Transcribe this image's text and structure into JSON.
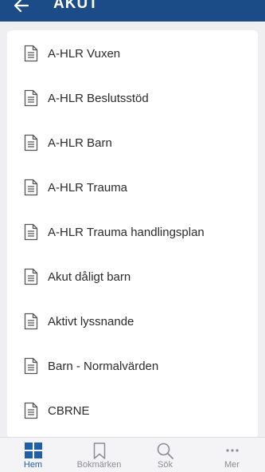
{
  "header": {
    "title": "AKUT",
    "back_icon": "arrow-left-icon",
    "background_color": "#1b4c88"
  },
  "list": {
    "items": [
      {
        "label": "A-HLR Vuxen",
        "icon": "document-icon"
      },
      {
        "label": "A-HLR Beslutsstöd",
        "icon": "document-icon"
      },
      {
        "label": "A-HLR Barn",
        "icon": "document-icon"
      },
      {
        "label": "A-HLR Trauma",
        "icon": "document-icon"
      },
      {
        "label": "A-HLR Trauma handlingsplan",
        "icon": "document-icon"
      },
      {
        "label": "Akut dåligt barn",
        "icon": "document-icon"
      },
      {
        "label": "Aktivt lyssnande",
        "icon": "document-icon"
      },
      {
        "label": "Barn - Normalvärden",
        "icon": "document-icon"
      },
      {
        "label": "CBRNE",
        "icon": "document-icon"
      }
    ]
  },
  "bottom_nav": {
    "items": [
      {
        "label": "Hem",
        "icon": "grid-icon",
        "active": true
      },
      {
        "label": "Bokmärken",
        "icon": "bookmark-icon",
        "active": false
      },
      {
        "label": "Sök",
        "icon": "search-icon",
        "active": false
      },
      {
        "label": "Mer",
        "icon": "more-icon",
        "active": false
      }
    ],
    "active_color": "#1f5fa9"
  }
}
